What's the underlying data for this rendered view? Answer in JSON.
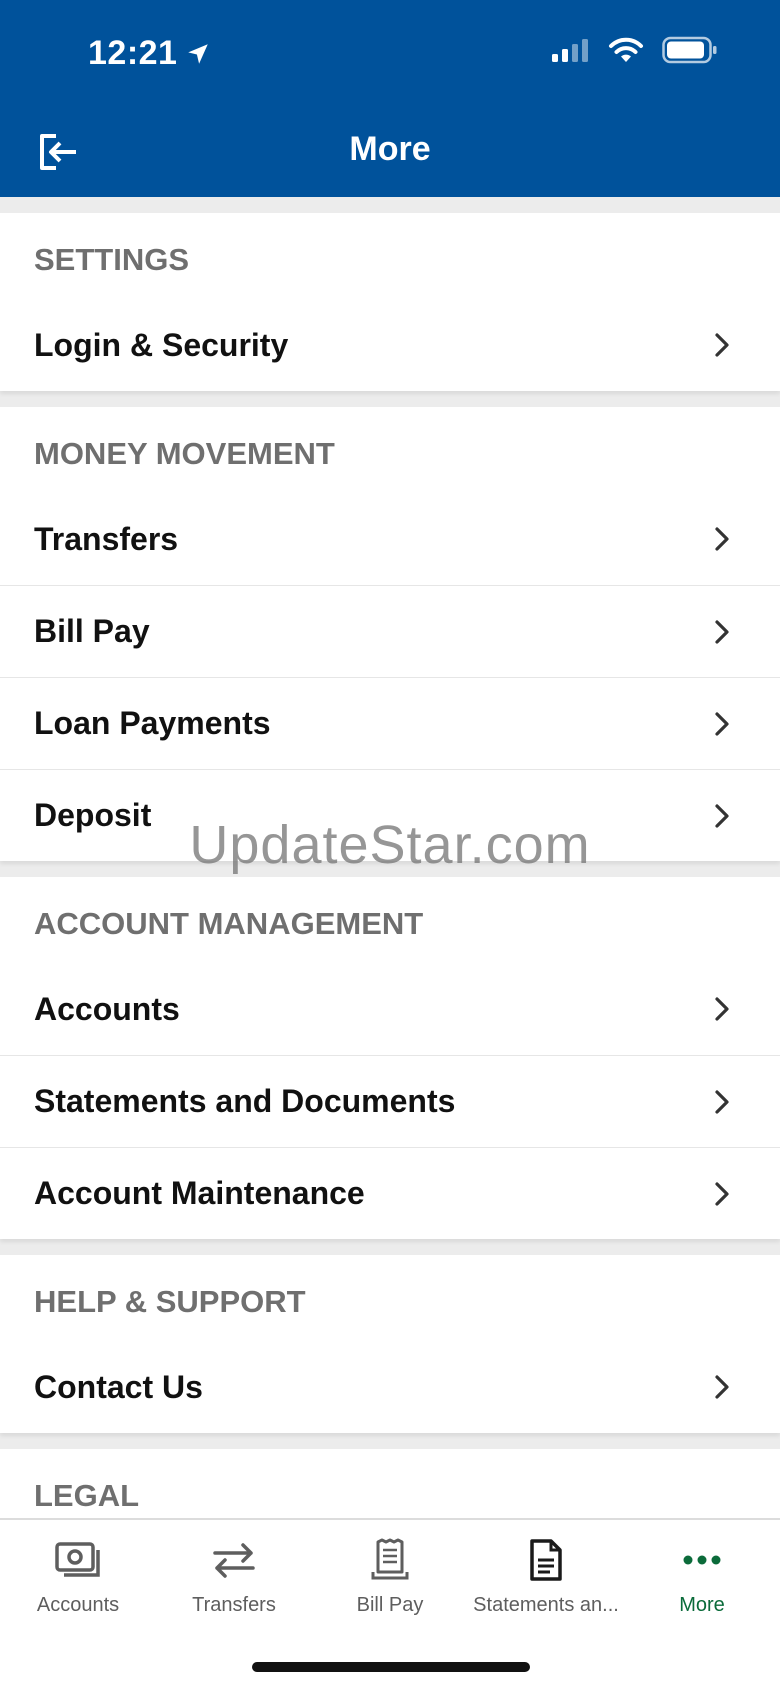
{
  "status_bar": {
    "time": "12:21",
    "icons": [
      "location-arrow-icon",
      "cellular-signal-icon",
      "wifi-icon",
      "battery-icon"
    ]
  },
  "nav": {
    "title": "More",
    "left_icon": "logout-icon"
  },
  "sections": [
    {
      "header": "SETTINGS",
      "items": [
        "Login & Security"
      ]
    },
    {
      "header": "MONEY MOVEMENT",
      "items": [
        "Transfers",
        "Bill Pay",
        "Loan Payments",
        "Deposit"
      ]
    },
    {
      "header": "ACCOUNT MANAGEMENT",
      "items": [
        "Accounts",
        "Statements and Documents",
        "Account Maintenance"
      ]
    },
    {
      "header": "HELP & SUPPORT",
      "items": [
        "Contact Us"
      ]
    },
    {
      "header": "LEGAL",
      "items": []
    }
  ],
  "watermark": "UpdateStar.com",
  "tab_bar": {
    "tabs": [
      {
        "label": "Accounts",
        "icon": "accounts-icon",
        "active": false
      },
      {
        "label": "Transfers",
        "icon": "transfers-icon",
        "active": false
      },
      {
        "label": "Bill Pay",
        "icon": "bill-pay-icon",
        "active": false
      },
      {
        "label": "Statements an...",
        "icon": "statements-icon",
        "active": false
      },
      {
        "label": "More",
        "icon": "more-icon",
        "active": true
      }
    ]
  },
  "colors": {
    "brand_blue": "#00529b",
    "active_tab": "#0b6b3a",
    "section_header": "#6f6f6f"
  }
}
